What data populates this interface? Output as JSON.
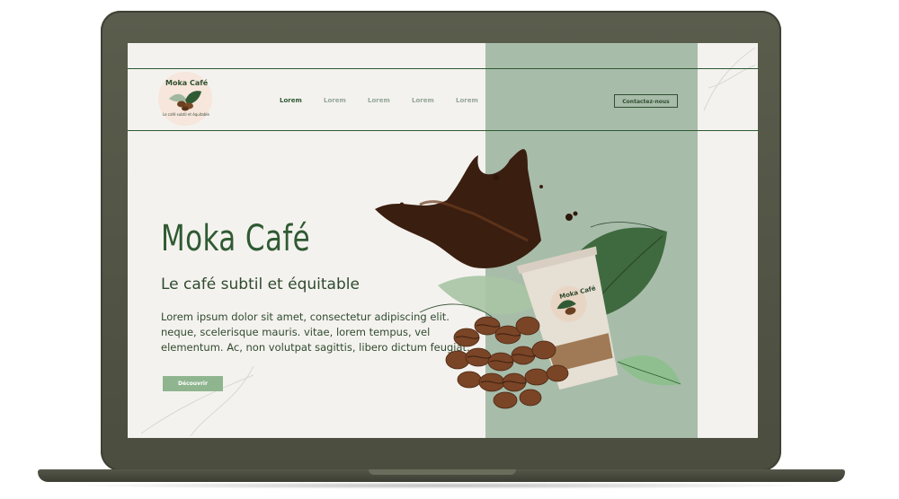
{
  "brand": {
    "name": "Moka Café",
    "tagline": "Le café subtil et équitable"
  },
  "nav": {
    "items": [
      {
        "label": "Lorem",
        "active": true
      },
      {
        "label": "Lorem",
        "active": false
      },
      {
        "label": "Lorem",
        "active": false
      },
      {
        "label": "Lorem",
        "active": false
      },
      {
        "label": "Lorem",
        "active": false
      }
    ],
    "contact_label": "Contactez-nous"
  },
  "hero": {
    "title": "Moka Café",
    "subtitle": "Le café subtil et équitable",
    "body_lines": [
      "Lorem ipsum dolor sit amet, consectetur adipiscing elit.",
      "neque, scelerisque mauris. vitae, lorem tempus, vel",
      "elementum. Ac, non volutpat sagittis, libero dictum feugiat."
    ],
    "cta_label": "Découvrir"
  },
  "cup": {
    "logo_text": "Moka Café"
  },
  "colors": {
    "dark_green": "#2f5a33",
    "sage_panel": "#a8bcaa",
    "cream_bg": "#f4f2ee",
    "cta_green": "#8fb58f",
    "laptop_frame": "#4b4d3f"
  }
}
